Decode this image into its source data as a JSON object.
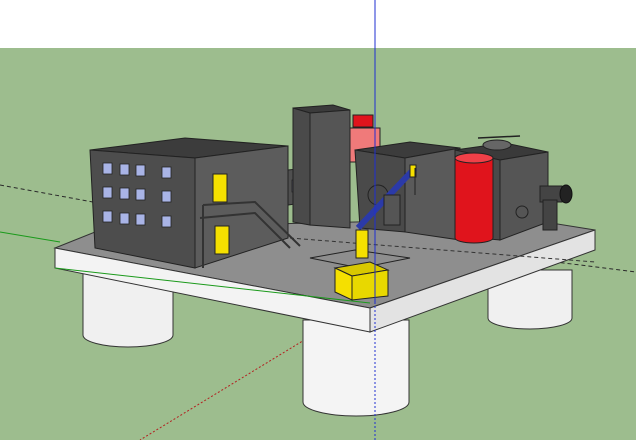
{
  "viewport": {
    "sky_color": "#ffffff",
    "ground_color": "#9dbd8e"
  },
  "colors": {
    "building_front": "#4a4a4a",
    "building_side": "#5c5c5c",
    "building_top": "#3c3c3c",
    "deck_top": "#8f8f8f",
    "deck_front": "#f2f2f2",
    "deck_side": "#e2e2e2",
    "pillar": "#f0f0f0",
    "window": "#a9b4e6",
    "door": "#f5e000",
    "crane_arm": "#2b3aa8",
    "red_tank": "#e0141c",
    "pink_block": "#f07a7a",
    "axis_blue": "#1f2fd1",
    "axis_green": "#1a9a1a",
    "axis_red": "#b32020"
  },
  "icons": [
    "crane-icon",
    "helicopter-icon",
    "fire-escape-icon",
    "exhaust-pipe-icon"
  ]
}
